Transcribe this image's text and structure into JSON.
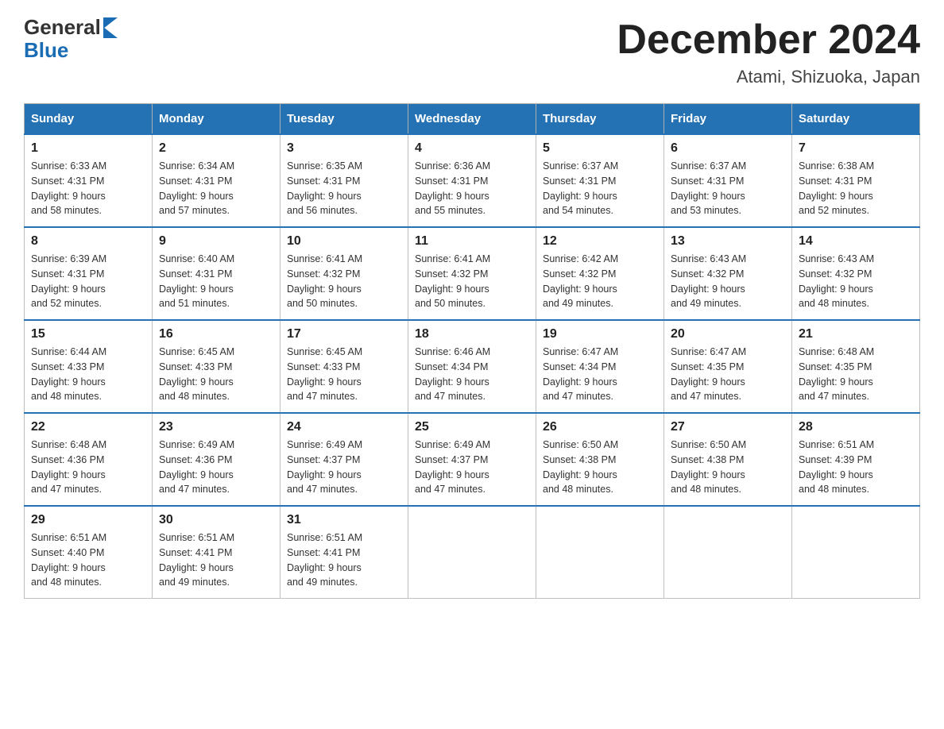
{
  "logo": {
    "text_general": "General",
    "text_blue": "Blue"
  },
  "title": "December 2024",
  "location": "Atami, Shizuoka, Japan",
  "weekdays": [
    "Sunday",
    "Monday",
    "Tuesday",
    "Wednesday",
    "Thursday",
    "Friday",
    "Saturday"
  ],
  "weeks": [
    [
      {
        "day": "1",
        "sunrise": "Sunrise: 6:33 AM",
        "sunset": "Sunset: 4:31 PM",
        "daylight": "Daylight: 9 hours",
        "daylight2": "and 58 minutes."
      },
      {
        "day": "2",
        "sunrise": "Sunrise: 6:34 AM",
        "sunset": "Sunset: 4:31 PM",
        "daylight": "Daylight: 9 hours",
        "daylight2": "and 57 minutes."
      },
      {
        "day": "3",
        "sunrise": "Sunrise: 6:35 AM",
        "sunset": "Sunset: 4:31 PM",
        "daylight": "Daylight: 9 hours",
        "daylight2": "and 56 minutes."
      },
      {
        "day": "4",
        "sunrise": "Sunrise: 6:36 AM",
        "sunset": "Sunset: 4:31 PM",
        "daylight": "Daylight: 9 hours",
        "daylight2": "and 55 minutes."
      },
      {
        "day": "5",
        "sunrise": "Sunrise: 6:37 AM",
        "sunset": "Sunset: 4:31 PM",
        "daylight": "Daylight: 9 hours",
        "daylight2": "and 54 minutes."
      },
      {
        "day": "6",
        "sunrise": "Sunrise: 6:37 AM",
        "sunset": "Sunset: 4:31 PM",
        "daylight": "Daylight: 9 hours",
        "daylight2": "and 53 minutes."
      },
      {
        "day": "7",
        "sunrise": "Sunrise: 6:38 AM",
        "sunset": "Sunset: 4:31 PM",
        "daylight": "Daylight: 9 hours",
        "daylight2": "and 52 minutes."
      }
    ],
    [
      {
        "day": "8",
        "sunrise": "Sunrise: 6:39 AM",
        "sunset": "Sunset: 4:31 PM",
        "daylight": "Daylight: 9 hours",
        "daylight2": "and 52 minutes."
      },
      {
        "day": "9",
        "sunrise": "Sunrise: 6:40 AM",
        "sunset": "Sunset: 4:31 PM",
        "daylight": "Daylight: 9 hours",
        "daylight2": "and 51 minutes."
      },
      {
        "day": "10",
        "sunrise": "Sunrise: 6:41 AM",
        "sunset": "Sunset: 4:32 PM",
        "daylight": "Daylight: 9 hours",
        "daylight2": "and 50 minutes."
      },
      {
        "day": "11",
        "sunrise": "Sunrise: 6:41 AM",
        "sunset": "Sunset: 4:32 PM",
        "daylight": "Daylight: 9 hours",
        "daylight2": "and 50 minutes."
      },
      {
        "day": "12",
        "sunrise": "Sunrise: 6:42 AM",
        "sunset": "Sunset: 4:32 PM",
        "daylight": "Daylight: 9 hours",
        "daylight2": "and 49 minutes."
      },
      {
        "day": "13",
        "sunrise": "Sunrise: 6:43 AM",
        "sunset": "Sunset: 4:32 PM",
        "daylight": "Daylight: 9 hours",
        "daylight2": "and 49 minutes."
      },
      {
        "day": "14",
        "sunrise": "Sunrise: 6:43 AM",
        "sunset": "Sunset: 4:32 PM",
        "daylight": "Daylight: 9 hours",
        "daylight2": "and 48 minutes."
      }
    ],
    [
      {
        "day": "15",
        "sunrise": "Sunrise: 6:44 AM",
        "sunset": "Sunset: 4:33 PM",
        "daylight": "Daylight: 9 hours",
        "daylight2": "and 48 minutes."
      },
      {
        "day": "16",
        "sunrise": "Sunrise: 6:45 AM",
        "sunset": "Sunset: 4:33 PM",
        "daylight": "Daylight: 9 hours",
        "daylight2": "and 48 minutes."
      },
      {
        "day": "17",
        "sunrise": "Sunrise: 6:45 AM",
        "sunset": "Sunset: 4:33 PM",
        "daylight": "Daylight: 9 hours",
        "daylight2": "and 47 minutes."
      },
      {
        "day": "18",
        "sunrise": "Sunrise: 6:46 AM",
        "sunset": "Sunset: 4:34 PM",
        "daylight": "Daylight: 9 hours",
        "daylight2": "and 47 minutes."
      },
      {
        "day": "19",
        "sunrise": "Sunrise: 6:47 AM",
        "sunset": "Sunset: 4:34 PM",
        "daylight": "Daylight: 9 hours",
        "daylight2": "and 47 minutes."
      },
      {
        "day": "20",
        "sunrise": "Sunrise: 6:47 AM",
        "sunset": "Sunset: 4:35 PM",
        "daylight": "Daylight: 9 hours",
        "daylight2": "and 47 minutes."
      },
      {
        "day": "21",
        "sunrise": "Sunrise: 6:48 AM",
        "sunset": "Sunset: 4:35 PM",
        "daylight": "Daylight: 9 hours",
        "daylight2": "and 47 minutes."
      }
    ],
    [
      {
        "day": "22",
        "sunrise": "Sunrise: 6:48 AM",
        "sunset": "Sunset: 4:36 PM",
        "daylight": "Daylight: 9 hours",
        "daylight2": "and 47 minutes."
      },
      {
        "day": "23",
        "sunrise": "Sunrise: 6:49 AM",
        "sunset": "Sunset: 4:36 PM",
        "daylight": "Daylight: 9 hours",
        "daylight2": "and 47 minutes."
      },
      {
        "day": "24",
        "sunrise": "Sunrise: 6:49 AM",
        "sunset": "Sunset: 4:37 PM",
        "daylight": "Daylight: 9 hours",
        "daylight2": "and 47 minutes."
      },
      {
        "day": "25",
        "sunrise": "Sunrise: 6:49 AM",
        "sunset": "Sunset: 4:37 PM",
        "daylight": "Daylight: 9 hours",
        "daylight2": "and 47 minutes."
      },
      {
        "day": "26",
        "sunrise": "Sunrise: 6:50 AM",
        "sunset": "Sunset: 4:38 PM",
        "daylight": "Daylight: 9 hours",
        "daylight2": "and 48 minutes."
      },
      {
        "day": "27",
        "sunrise": "Sunrise: 6:50 AM",
        "sunset": "Sunset: 4:38 PM",
        "daylight": "Daylight: 9 hours",
        "daylight2": "and 48 minutes."
      },
      {
        "day": "28",
        "sunrise": "Sunrise: 6:51 AM",
        "sunset": "Sunset: 4:39 PM",
        "daylight": "Daylight: 9 hours",
        "daylight2": "and 48 minutes."
      }
    ],
    [
      {
        "day": "29",
        "sunrise": "Sunrise: 6:51 AM",
        "sunset": "Sunset: 4:40 PM",
        "daylight": "Daylight: 9 hours",
        "daylight2": "and 48 minutes."
      },
      {
        "day": "30",
        "sunrise": "Sunrise: 6:51 AM",
        "sunset": "Sunset: 4:41 PM",
        "daylight": "Daylight: 9 hours",
        "daylight2": "and 49 minutes."
      },
      {
        "day": "31",
        "sunrise": "Sunrise: 6:51 AM",
        "sunset": "Sunset: 4:41 PM",
        "daylight": "Daylight: 9 hours",
        "daylight2": "and 49 minutes."
      },
      null,
      null,
      null,
      null
    ]
  ]
}
